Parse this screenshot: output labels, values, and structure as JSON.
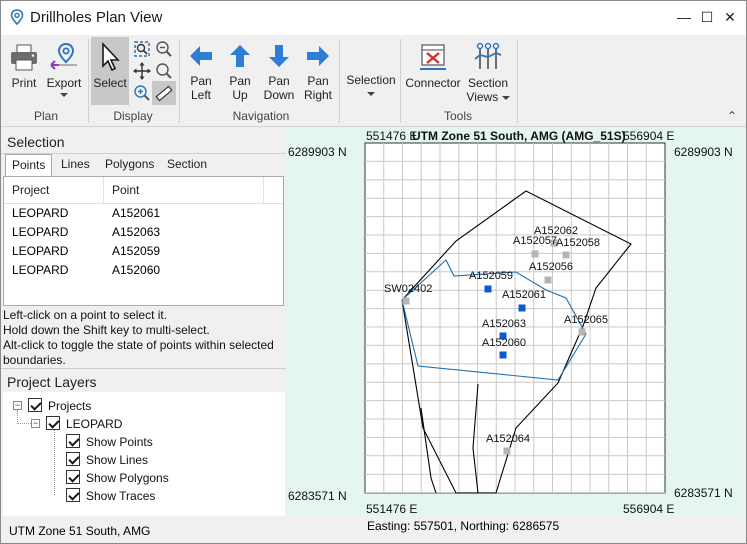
{
  "window": {
    "title": "Drillholes Plan View",
    "controls": [
      "—",
      "☐",
      "✕"
    ]
  },
  "ribbon": {
    "groups": [
      {
        "label": "Plan",
        "buttons": [
          {
            "label": "Print"
          },
          {
            "label": "Export"
          }
        ]
      },
      {
        "label": "Display",
        "buttons": [
          {
            "label": "Select"
          }
        ]
      },
      {
        "label": "Navigation",
        "buttons": [
          {
            "label1": "Pan",
            "label2": "Left"
          },
          {
            "label1": "Pan",
            "label2": "Up"
          },
          {
            "label1": "Pan",
            "label2": "Down"
          },
          {
            "label1": "Pan",
            "label2": "Right"
          }
        ]
      },
      {
        "label": "",
        "buttons": [
          {
            "label": "Selection"
          }
        ]
      },
      {
        "label": "Tools",
        "buttons": [
          {
            "label": "Connector"
          },
          {
            "label1": "Section",
            "label2": "Views"
          }
        ]
      }
    ],
    "collapse_glyph": "⌃"
  },
  "selection": {
    "header": "Selection",
    "tabs": [
      "Points",
      "Lines",
      "Polygons",
      "Section"
    ],
    "active_tab": "Points",
    "columns": [
      "Project",
      "Point"
    ],
    "rows": [
      {
        "project": "LEOPARD",
        "point": "A152061"
      },
      {
        "project": "LEOPARD",
        "point": "A152063"
      },
      {
        "project": "LEOPARD",
        "point": "A152059"
      },
      {
        "project": "LEOPARD",
        "point": "A152060"
      }
    ],
    "help": [
      "Left-click on a point to select it.",
      "Hold down the Shift key to multi-select.",
      "Alt-click to toggle the state of points within selected",
      "boundaries."
    ]
  },
  "layers": {
    "header": "Project Layers",
    "root": "Projects",
    "project": "LEOPARD",
    "options": [
      "Show Points",
      "Show Lines",
      "Show Polygons",
      "Show Traces"
    ]
  },
  "map": {
    "title": "UTM Zone 51 South, AMG (AMG_51S)",
    "top_left_x": "551476 E",
    "top_right_x": "556904 E",
    "bottom_left_x": "551476 E",
    "bottom_right_x": "556904 E",
    "top_y_left": "6289903 N",
    "top_y_right": "6289903 N",
    "bottom_y_left": "6283571 N",
    "bottom_y_right": "6283571 N",
    "points": [
      {
        "name": "A152062",
        "selected": false
      },
      {
        "name": "A152057",
        "selected": false
      },
      {
        "name": "A152058",
        "selected": false
      },
      {
        "name": "A152056",
        "selected": false
      },
      {
        "name": "A152059",
        "selected": true
      },
      {
        "name": "A152061",
        "selected": true
      },
      {
        "name": "SW02402",
        "selected": false
      },
      {
        "name": "A152063",
        "selected": true
      },
      {
        "name": "A152065",
        "selected": false
      },
      {
        "name": "A152060",
        "selected": true
      },
      {
        "name": "A152064",
        "selected": false
      }
    ],
    "colors": {
      "selected": "#0a5bd0",
      "unselected": "#b4b4b4",
      "boundary": "#000000",
      "polygon": "#1d6fb0",
      "background": "#e4f6ef"
    }
  },
  "status": {
    "left": "UTM Zone 51 South, AMG",
    "coords": "Easting: 557501, Northing: 6286575"
  }
}
